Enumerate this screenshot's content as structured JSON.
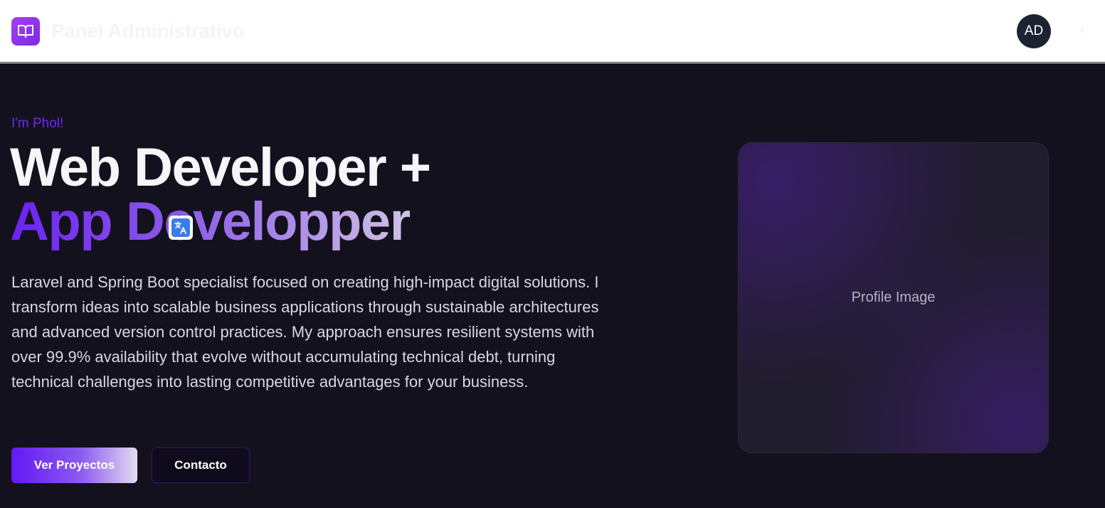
{
  "header": {
    "title": "Panel Administrativo",
    "logo_icon": "open-book-icon",
    "avatar_initials": "AD",
    "close_symbol": "×"
  },
  "hero": {
    "greeting": "I'm Phol!",
    "title_line1": "Web Developer +",
    "title_line2": "App Developper",
    "description": "Laravel and Spring Boot specialist focused on creating high-impact digital solutions. I transform ideas into scalable business applications through sustainable architectures and advanced version control practices. My approach ensures resilient systems with over 99.9% availability that evolve without accumulating technical debt, turning technical challenges into lasting competitive advantages for your business.",
    "primary_button": "Ver Proyectos",
    "secondary_button": "Contacto",
    "profile_image_label": "Profile Image"
  },
  "colors": {
    "accent": "#6a2cf5",
    "hero_background": "#14111e",
    "logo_gradient_start": "#a63ff0",
    "avatar_background": "#1c2333"
  }
}
